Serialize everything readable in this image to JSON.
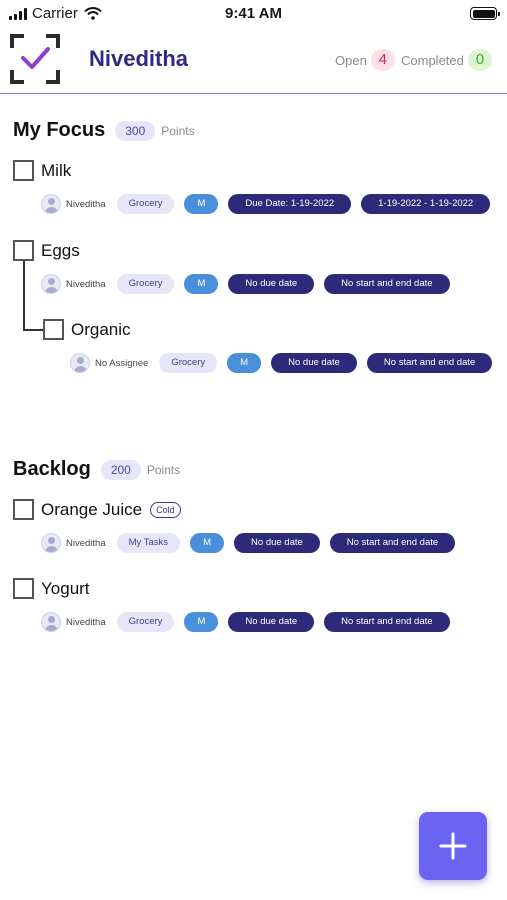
{
  "status_bar": {
    "carrier": "Carrier",
    "time": "9:41 AM"
  },
  "header": {
    "user_name": "Niveditha",
    "open_label": "Open",
    "open_count": "4",
    "completed_label": "Completed",
    "completed_count": "0"
  },
  "focus": {
    "title": "My Focus",
    "points": "300",
    "points_label": "Points",
    "tasks": [
      {
        "title": "Milk",
        "assignee": "Niveditha",
        "list": "Grocery",
        "size": "M",
        "due": "Due Date: 1-19-2022",
        "range": "1-19-2022 - 1-19-2022"
      },
      {
        "title": "Eggs",
        "assignee": "Niveditha",
        "list": "Grocery",
        "size": "M",
        "due": "No due date",
        "range": "No start and end date"
      },
      {
        "title": "Organic",
        "assignee": "No Assignee",
        "list": "Grocery",
        "size": "M",
        "due": "No due date",
        "range": "No start and end date"
      }
    ]
  },
  "backlog": {
    "title": "Backlog",
    "points": "200",
    "points_label": "Points",
    "tasks": [
      {
        "title": "Orange Juice",
        "tag": "Cold",
        "assignee": "Niveditha",
        "list": "My Tasks",
        "size": "M",
        "due": "No due date",
        "range": "No start and end date"
      },
      {
        "title": "Yogurt",
        "assignee": "Niveditha",
        "list": "Grocery",
        "size": "M",
        "due": "No due date",
        "range": "No start and end date"
      }
    ]
  },
  "colors": {
    "accent": "#2e2a86",
    "fab": "#6b63f2",
    "open_badge": "#e0245e",
    "completed_badge": "#3cae2c",
    "size_pill": "#4a8fd9"
  },
  "icons": {
    "logo": "checked-frame-icon",
    "fab": "plus-icon"
  }
}
